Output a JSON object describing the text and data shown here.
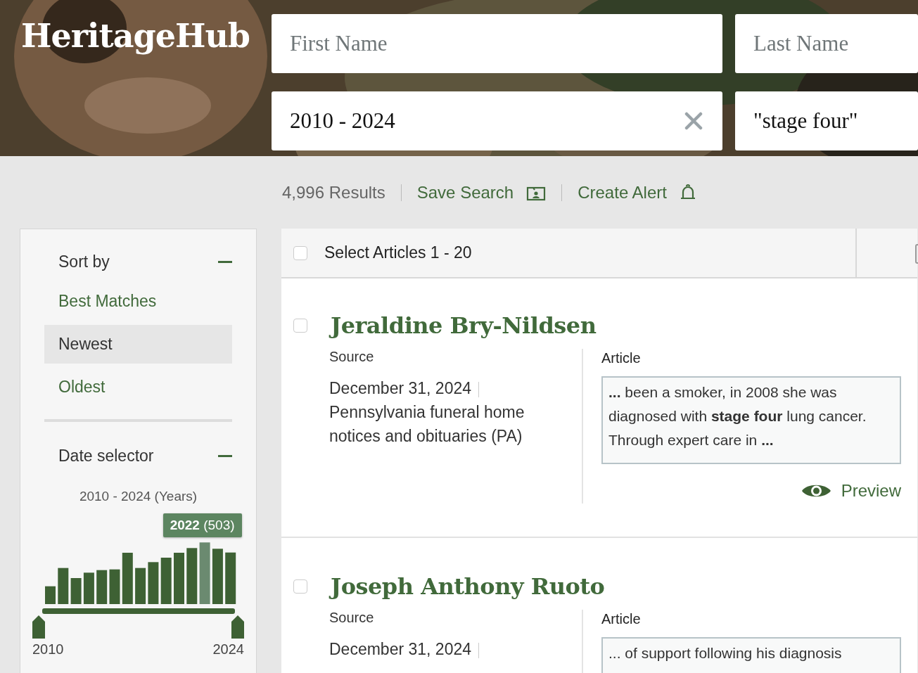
{
  "logo": "HeritageHub",
  "search": {
    "first_name": {
      "placeholder": "First Name"
    },
    "last_name": {
      "placeholder": "Last Name"
    },
    "date_range": {
      "value": "2010 - 2024"
    },
    "keywords": {
      "value": "\"stage four\""
    }
  },
  "results_bar": {
    "count": "4,996 Results",
    "save_search": "Save Search",
    "create_alert": "Create Alert"
  },
  "sidebar": {
    "sort": {
      "title": "Sort by",
      "expanded": true,
      "options": [
        {
          "label": "Best Matches",
          "selected": false
        },
        {
          "label": "Newest",
          "selected": true
        },
        {
          "label": "Oldest",
          "selected": false
        }
      ]
    },
    "date_selector": {
      "title": "Date selector",
      "expanded": true,
      "range_label": "2010 - 2024 (Years)",
      "tooltip": "**2022** (503)",
      "bars": [
        {
          "selected": false
        },
        {
          "selected": false
        },
        {
          "selected": false
        },
        {
          "selected": false
        },
        {
          "selected": false
        },
        {
          "selected": false
        },
        {
          "selected": false
        },
        {
          "selected": false
        },
        {
          "selected": false
        },
        {
          "selected": false
        },
        {
          "selected": false
        },
        {
          "selected": false
        },
        {
          "selected": true
        },
        {
          "selected": false
        },
        {
          "selected": false
        }
      ],
      "start": "2010",
      "end": "2024"
    }
  },
  "list_header": {
    "select_label": "Select Articles 1 - 20",
    "checked": false
  },
  "results": [
    {
      "name": "Jeraldine Bry-Nildsen",
      "checked": false,
      "source_label": "Source",
      "date": "December 31, 2024",
      "source": "Pennsylvania funeral home notices and obituaries (PA)",
      "article_label": "Article",
      "snippet": "**...** been a smoker, in 2008 she was diagnosed with **stage four** lung cancer. Through expert care in **...**",
      "preview": "Preview"
    },
    {
      "name": "Joseph Anthony Ruoto",
      "checked": false,
      "source_label": "Source",
      "date": "December 31, 2024",
      "article_label": "Article",
      "snippet": "... of support following his diagnosis"
    }
  ]
}
